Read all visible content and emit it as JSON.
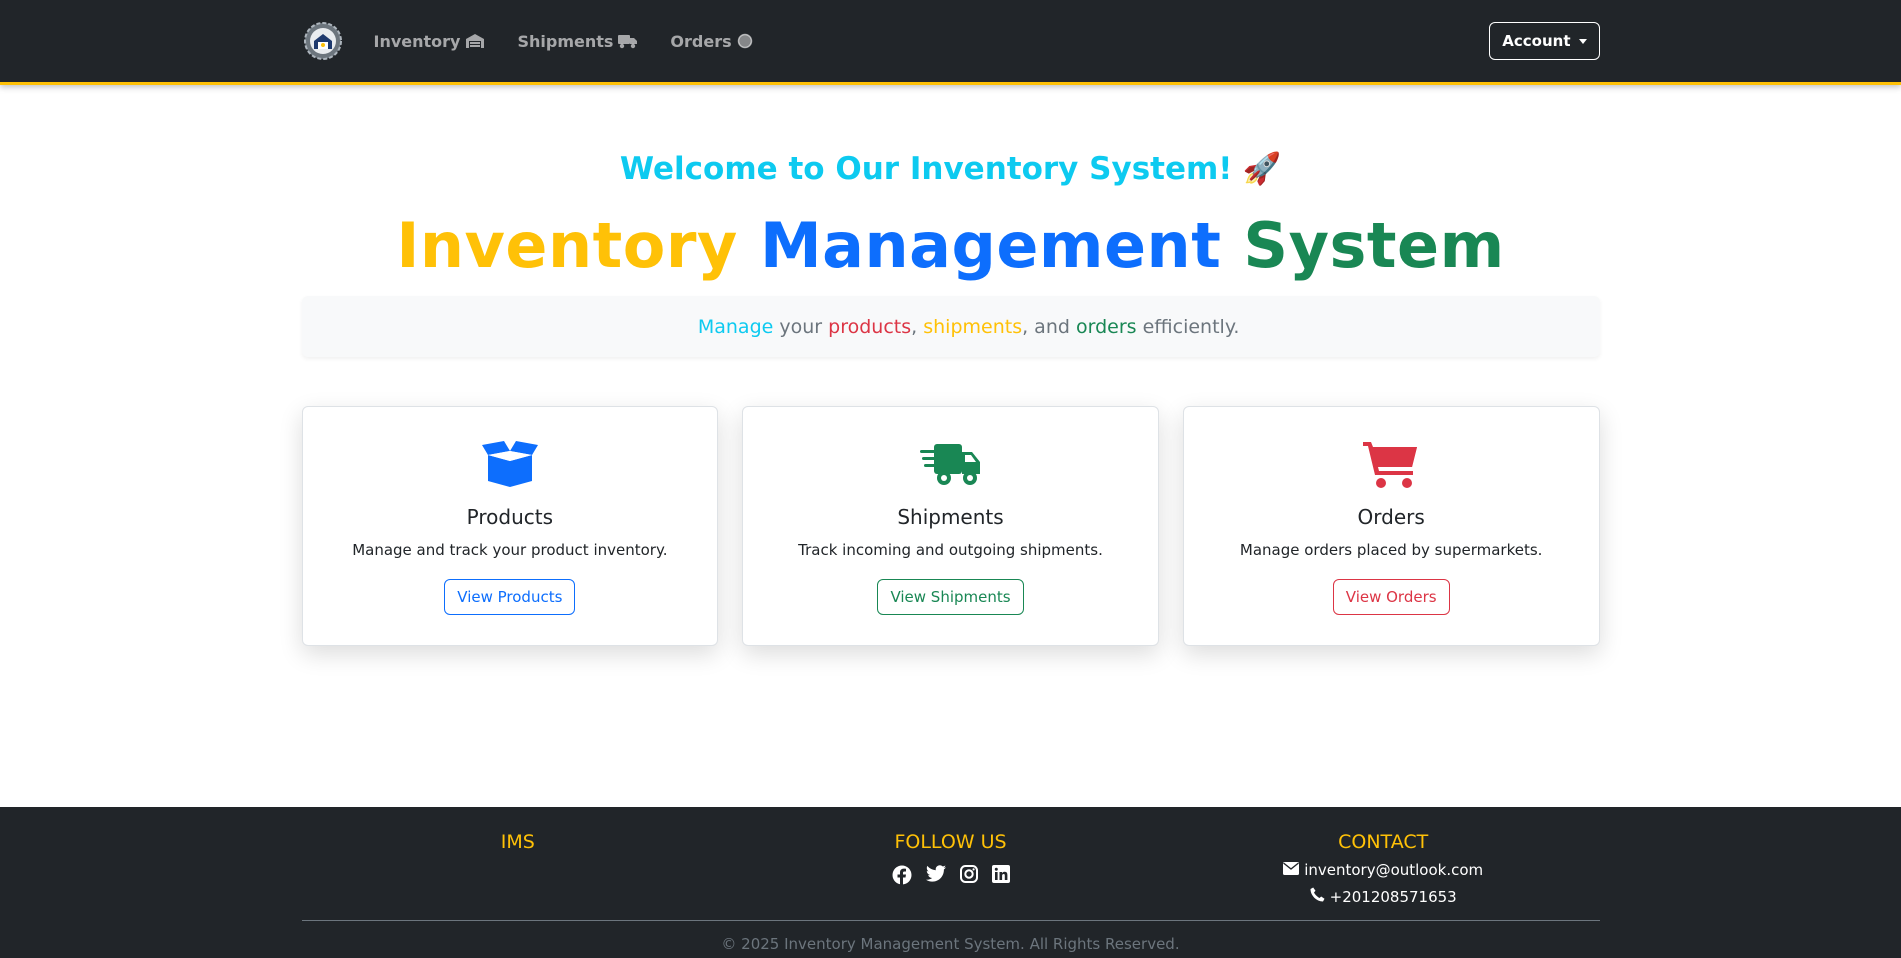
{
  "nav": {
    "links": [
      {
        "label": "Inventory",
        "icon": "warehouse-icon"
      },
      {
        "label": "Shipments",
        "icon": "truck-icon"
      },
      {
        "label": "Orders",
        "icon": "circle-icon"
      }
    ],
    "account_label": "Account"
  },
  "hero": {
    "welcome": "Welcome to Our Inventory System!",
    "welcome_emoji": "🚀",
    "title_part1": "Inventory",
    "title_part2": "Management",
    "title_part3": "System",
    "lead": {
      "w1": "Manage",
      "w2": " your ",
      "w3": "products",
      "w4": ", ",
      "w5": "shipments",
      "w6": ", and ",
      "w7": "orders",
      "w8": " efficiently."
    }
  },
  "cards": [
    {
      "title": "Products",
      "text": "Manage and track your product inventory.",
      "button": "View Products",
      "color": "#0d6efd",
      "icon": "box-open-icon"
    },
    {
      "title": "Shipments",
      "text": "Track incoming and outgoing shipments.",
      "button": "View Shipments",
      "color": "#198754",
      "icon": "truck-fast-icon"
    },
    {
      "title": "Orders",
      "text": "Manage orders placed by supermarkets.",
      "button": "View Orders",
      "color": "#dc3545",
      "icon": "cart-icon"
    }
  ],
  "footer": {
    "col1_head": "IMS",
    "col2_head": "FOLLOW US",
    "col3_head": "CONTACT",
    "email": "inventory@outlook.com",
    "phone": "+201208571653",
    "copyright": "© 2025 Inventory Management System. All Rights Reserved."
  },
  "colors": {
    "navbar": "#212529",
    "accent": "#ffc107",
    "primary": "#0d6efd",
    "success": "#198754",
    "danger": "#dc3545",
    "info": "#0dcaf0"
  }
}
